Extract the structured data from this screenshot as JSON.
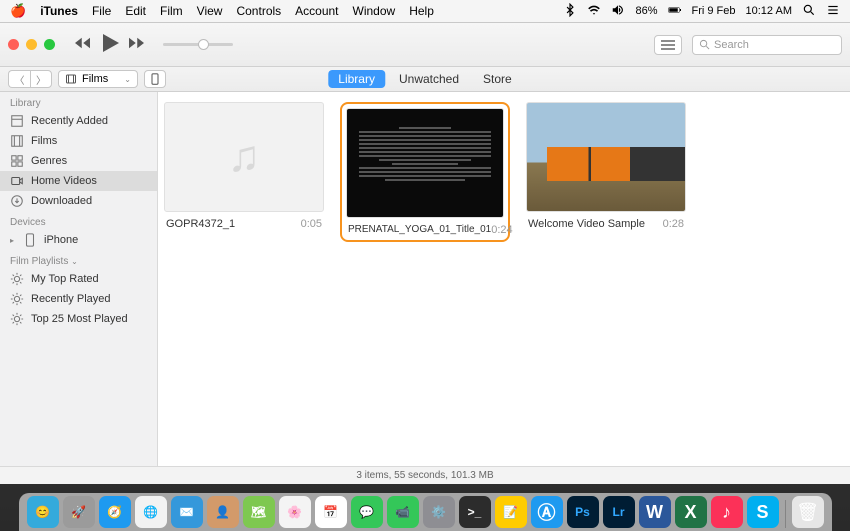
{
  "menubar": {
    "app": "iTunes",
    "items": [
      "File",
      "Edit",
      "Film",
      "View",
      "Controls",
      "Account",
      "Window",
      "Help"
    ],
    "battery": "86%",
    "date": "Fri 9 Feb",
    "time": "10:12 AM"
  },
  "titlebar": {
    "search_placeholder": "Search"
  },
  "toolbar": {
    "media_type": "Films",
    "tabs": {
      "library": "Library",
      "unwatched": "Unwatched",
      "store": "Store"
    }
  },
  "sidebar": {
    "library_header": "Library",
    "library_items": [
      {
        "label": "Recently Added",
        "icon": "recent-icon"
      },
      {
        "label": "Films",
        "icon": "films-icon"
      },
      {
        "label": "Genres",
        "icon": "genres-icon"
      },
      {
        "label": "Home Videos",
        "icon": "home-icon",
        "selected": true
      },
      {
        "label": "Downloaded",
        "icon": "download-icon"
      }
    ],
    "devices_header": "Devices",
    "devices": [
      {
        "label": "iPhone",
        "icon": "phone-icon"
      }
    ],
    "playlists_header": "Film Playlists",
    "playlists": [
      {
        "label": "My Top Rated",
        "icon": "gear-icon"
      },
      {
        "label": "Recently Played",
        "icon": "gear-icon"
      },
      {
        "label": "Top 25 Most Played",
        "icon": "gear-icon"
      }
    ]
  },
  "videos": [
    {
      "title": "GOPR4372_1",
      "duration": "0:05",
      "thumb": "placeholder"
    },
    {
      "title": "PRENATAL_YOGA_01_Title_01",
      "duration": "0:24",
      "thumb": "dark",
      "highlighted": true
    },
    {
      "title": "Welcome Video Sample",
      "duration": "0:28",
      "thumb": "train"
    }
  ],
  "status": "3 items, 55 seconds, 101.3 MB",
  "dock": [
    {
      "name": "finder",
      "bg": "#34aadc"
    },
    {
      "name": "launchpad",
      "bg": "#9b9b9b"
    },
    {
      "name": "safari",
      "bg": "#1e9af0"
    },
    {
      "name": "chrome",
      "bg": "#f2f2f2"
    },
    {
      "name": "mail",
      "bg": "#3498db"
    },
    {
      "name": "contacts",
      "bg": "#d39a6a"
    },
    {
      "name": "maps",
      "bg": "#7ec850"
    },
    {
      "name": "photos",
      "bg": "#f4f4f4"
    },
    {
      "name": "calendar",
      "bg": "#ffffff"
    },
    {
      "name": "messages",
      "bg": "#34c759"
    },
    {
      "name": "facetime",
      "bg": "#34c759"
    },
    {
      "name": "preferences",
      "bg": "#8e8e93"
    },
    {
      "name": "terminal",
      "bg": "#2c2c2c"
    },
    {
      "name": "notes",
      "bg": "#ffcc00"
    },
    {
      "name": "appstore",
      "bg": "#1e9af0"
    },
    {
      "name": "photoshop",
      "bg": "#001d34"
    },
    {
      "name": "lightroom",
      "bg": "#001d34"
    },
    {
      "name": "word",
      "bg": "#2b579a"
    },
    {
      "name": "excel",
      "bg": "#217346"
    },
    {
      "name": "itunes",
      "bg": "#fc3158"
    },
    {
      "name": "skype",
      "bg": "#00aff0"
    }
  ]
}
